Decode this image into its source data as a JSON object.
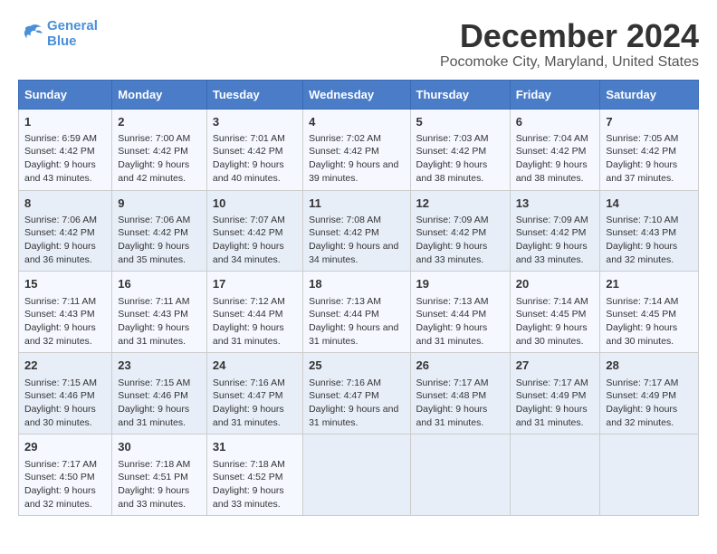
{
  "logo": {
    "line1": "General",
    "line2": "Blue"
  },
  "title": "December 2024",
  "subtitle": "Pocomoke City, Maryland, United States",
  "days_of_week": [
    "Sunday",
    "Monday",
    "Tuesday",
    "Wednesday",
    "Thursday",
    "Friday",
    "Saturday"
  ],
  "weeks": [
    [
      {
        "day": "1",
        "sunrise": "6:59 AM",
        "sunset": "4:42 PM",
        "daylight": "9 hours and 43 minutes."
      },
      {
        "day": "2",
        "sunrise": "7:00 AM",
        "sunset": "4:42 PM",
        "daylight": "9 hours and 42 minutes."
      },
      {
        "day": "3",
        "sunrise": "7:01 AM",
        "sunset": "4:42 PM",
        "daylight": "9 hours and 40 minutes."
      },
      {
        "day": "4",
        "sunrise": "7:02 AM",
        "sunset": "4:42 PM",
        "daylight": "9 hours and 39 minutes."
      },
      {
        "day": "5",
        "sunrise": "7:03 AM",
        "sunset": "4:42 PM",
        "daylight": "9 hours and 38 minutes."
      },
      {
        "day": "6",
        "sunrise": "7:04 AM",
        "sunset": "4:42 PM",
        "daylight": "9 hours and 38 minutes."
      },
      {
        "day": "7",
        "sunrise": "7:05 AM",
        "sunset": "4:42 PM",
        "daylight": "9 hours and 37 minutes."
      }
    ],
    [
      {
        "day": "8",
        "sunrise": "7:06 AM",
        "sunset": "4:42 PM",
        "daylight": "9 hours and 36 minutes."
      },
      {
        "day": "9",
        "sunrise": "7:06 AM",
        "sunset": "4:42 PM",
        "daylight": "9 hours and 35 minutes."
      },
      {
        "day": "10",
        "sunrise": "7:07 AM",
        "sunset": "4:42 PM",
        "daylight": "9 hours and 34 minutes."
      },
      {
        "day": "11",
        "sunrise": "7:08 AM",
        "sunset": "4:42 PM",
        "daylight": "9 hours and 34 minutes."
      },
      {
        "day": "12",
        "sunrise": "7:09 AM",
        "sunset": "4:42 PM",
        "daylight": "9 hours and 33 minutes."
      },
      {
        "day": "13",
        "sunrise": "7:09 AM",
        "sunset": "4:42 PM",
        "daylight": "9 hours and 33 minutes."
      },
      {
        "day": "14",
        "sunrise": "7:10 AM",
        "sunset": "4:43 PM",
        "daylight": "9 hours and 32 minutes."
      }
    ],
    [
      {
        "day": "15",
        "sunrise": "7:11 AM",
        "sunset": "4:43 PM",
        "daylight": "9 hours and 32 minutes."
      },
      {
        "day": "16",
        "sunrise": "7:11 AM",
        "sunset": "4:43 PM",
        "daylight": "9 hours and 31 minutes."
      },
      {
        "day": "17",
        "sunrise": "7:12 AM",
        "sunset": "4:44 PM",
        "daylight": "9 hours and 31 minutes."
      },
      {
        "day": "18",
        "sunrise": "7:13 AM",
        "sunset": "4:44 PM",
        "daylight": "9 hours and 31 minutes."
      },
      {
        "day": "19",
        "sunrise": "7:13 AM",
        "sunset": "4:44 PM",
        "daylight": "9 hours and 31 minutes."
      },
      {
        "day": "20",
        "sunrise": "7:14 AM",
        "sunset": "4:45 PM",
        "daylight": "9 hours and 30 minutes."
      },
      {
        "day": "21",
        "sunrise": "7:14 AM",
        "sunset": "4:45 PM",
        "daylight": "9 hours and 30 minutes."
      }
    ],
    [
      {
        "day": "22",
        "sunrise": "7:15 AM",
        "sunset": "4:46 PM",
        "daylight": "9 hours and 30 minutes."
      },
      {
        "day": "23",
        "sunrise": "7:15 AM",
        "sunset": "4:46 PM",
        "daylight": "9 hours and 31 minutes."
      },
      {
        "day": "24",
        "sunrise": "7:16 AM",
        "sunset": "4:47 PM",
        "daylight": "9 hours and 31 minutes."
      },
      {
        "day": "25",
        "sunrise": "7:16 AM",
        "sunset": "4:47 PM",
        "daylight": "9 hours and 31 minutes."
      },
      {
        "day": "26",
        "sunrise": "7:17 AM",
        "sunset": "4:48 PM",
        "daylight": "9 hours and 31 minutes."
      },
      {
        "day": "27",
        "sunrise": "7:17 AM",
        "sunset": "4:49 PM",
        "daylight": "9 hours and 31 minutes."
      },
      {
        "day": "28",
        "sunrise": "7:17 AM",
        "sunset": "4:49 PM",
        "daylight": "9 hours and 32 minutes."
      }
    ],
    [
      {
        "day": "29",
        "sunrise": "7:17 AM",
        "sunset": "4:50 PM",
        "daylight": "9 hours and 32 minutes."
      },
      {
        "day": "30",
        "sunrise": "7:18 AM",
        "sunset": "4:51 PM",
        "daylight": "9 hours and 33 minutes."
      },
      {
        "day": "31",
        "sunrise": "7:18 AM",
        "sunset": "4:52 PM",
        "daylight": "9 hours and 33 minutes."
      },
      null,
      null,
      null,
      null
    ]
  ]
}
